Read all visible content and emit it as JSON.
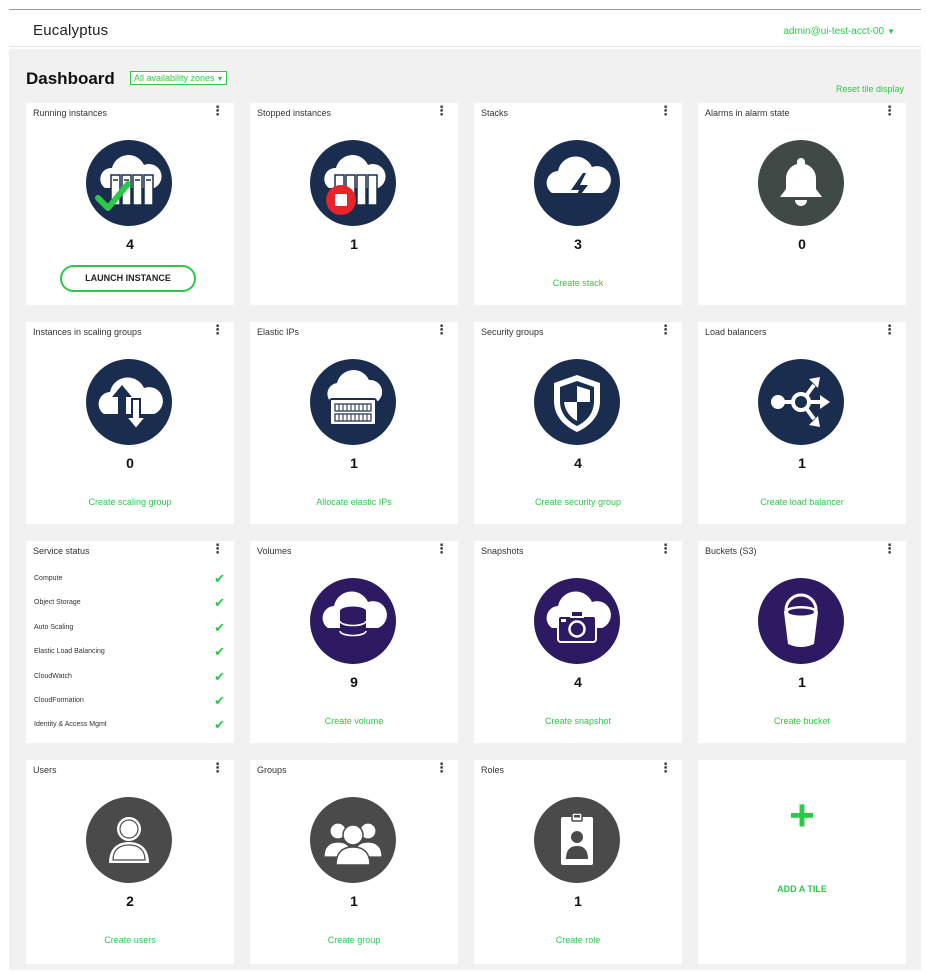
{
  "header": {
    "brand": "Eucalyptus",
    "user": "admin@ui-test-acct-00"
  },
  "dashboard": {
    "title": "Dashboard",
    "zone_select": "All availability zones",
    "reset_link": "Reset tile display"
  },
  "colors": {
    "accent": "#2cc84a",
    "navy_circle": "#1b2d4f",
    "purple_circle": "#2d1a63",
    "gray_circle": "#4a4a4a",
    "stop_red": "#e8232a"
  },
  "tiles": [
    {
      "title": "Running instances",
      "count": "4",
      "button": "LAUNCH INSTANCE",
      "icon": "cloud-server-running-icon"
    },
    {
      "title": "Stopped instances",
      "count": "1",
      "icon": "cloud-server-stopped-icon"
    },
    {
      "title": "Stacks",
      "count": "3",
      "link": "Create stack",
      "icon": "cloud-lightning-icon"
    },
    {
      "title": "Alarms in alarm state",
      "count": "0",
      "icon": "bell-icon"
    },
    {
      "title": "Instances in scaling groups",
      "count": "0",
      "link": "Create scaling group",
      "icon": "cloud-up-down-icon"
    },
    {
      "title": "Elastic IPs",
      "count": "1",
      "link": "Allocate elastic IPs",
      "icon": "cloud-ip-icon"
    },
    {
      "title": "Security groups",
      "count": "4",
      "link": "Create security group",
      "icon": "shield-icon"
    },
    {
      "title": "Load balancers",
      "count": "1",
      "link": "Create load balancer",
      "icon": "load-balancer-icon"
    },
    {
      "title": "Service status",
      "icon": "service-status-icon"
    },
    {
      "title": "Volumes",
      "count": "9",
      "link": "Create volume",
      "icon": "cloud-database-icon"
    },
    {
      "title": "Snapshots",
      "count": "4",
      "link": "Create snapshot",
      "icon": "cloud-camera-icon"
    },
    {
      "title": "Buckets (S3)",
      "count": "1",
      "link": "Create bucket",
      "icon": "bucket-icon"
    },
    {
      "title": "Users",
      "count": "2",
      "link": "Create users",
      "icon": "user-icon"
    },
    {
      "title": "Groups",
      "count": "1",
      "link": "Create group",
      "icon": "group-icon"
    },
    {
      "title": "Roles",
      "count": "1",
      "link": "Create role",
      "icon": "role-badge-icon"
    },
    {
      "add_label": "ADD A TILE",
      "icon": "plus-icon"
    }
  ],
  "service_status": [
    {
      "name": "Compute",
      "status": "ok"
    },
    {
      "name": "Object Storage",
      "status": "ok"
    },
    {
      "name": "Auto Scaling",
      "status": "ok"
    },
    {
      "name": "Elastic Load Balancing",
      "status": "ok"
    },
    {
      "name": "CloudWatch",
      "status": "ok"
    },
    {
      "name": "CloudFormation",
      "status": "ok"
    },
    {
      "name": "Identity & Access Mgmt",
      "status": "ok"
    }
  ]
}
